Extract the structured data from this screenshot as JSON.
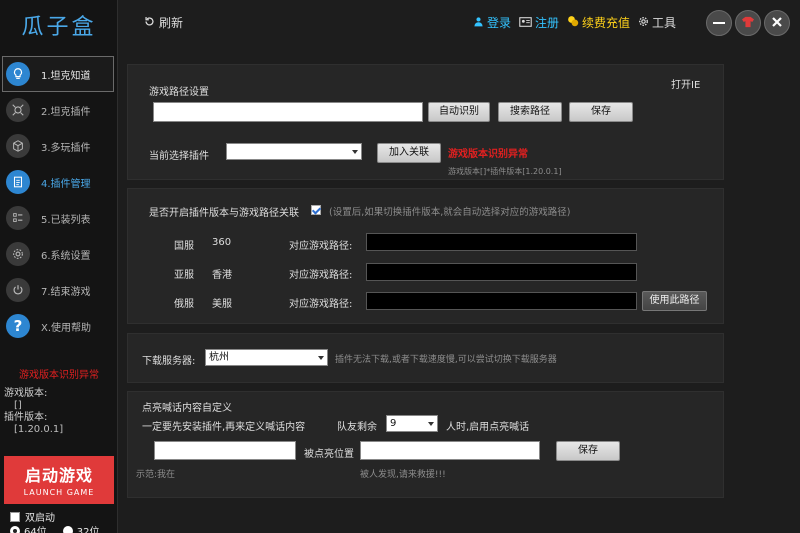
{
  "app": {
    "logo": "瓜子盒"
  },
  "sidebar": {
    "items": [
      {
        "label": "1.坦克知道"
      },
      {
        "label": "2.坦克插件"
      },
      {
        "label": "3.多玩插件"
      },
      {
        "label": "4.插件管理"
      },
      {
        "label": "5.已装列表"
      },
      {
        "label": "6.系统设置"
      },
      {
        "label": "7.结束游戏"
      },
      {
        "label": "X.使用帮助"
      }
    ],
    "status_error": "游戏版本识别异常",
    "game_version_label": "游戏版本:",
    "game_version_value": "[]",
    "plugin_version_label": "插件版本:",
    "plugin_version_value": "[1.20.0.1]",
    "launch_title": "启动游戏",
    "launch_sub": "LAUNCH GAME",
    "dual_label": "双启动",
    "bit64_label": "64位",
    "bit32_label": "32位"
  },
  "topbar": {
    "refresh": "刷新",
    "login": "登录",
    "register": "注册",
    "recharge": "续费充值",
    "tools": "工具"
  },
  "path_panel": {
    "title": "游戏路径设置",
    "open_ie": "打开IE",
    "path_value": "",
    "auto_detect": "自动识别",
    "search_path": "搜索路径",
    "save": "保存",
    "current_plugin_label": "当前选择插件",
    "current_plugin_value": "",
    "link_button": "加入关联",
    "version_error": "游戏版本识别异常",
    "version_info": "游戏版本[]*插件版本[1.20.0.1]"
  },
  "server_panel": {
    "question": "是否开启插件版本与游戏路径关联",
    "note": "(设置后,如果切换插件版本,就会自动选择对应的游戏路径)",
    "rows": [
      {
        "region": "国服",
        "server": "360",
        "path_label": "对应游戏路径:",
        "path": ""
      },
      {
        "region": "亚服",
        "server": "香港",
        "path_label": "对应游戏路径:",
        "path": ""
      },
      {
        "region": "俄服",
        "server": "美服",
        "path_label": "对应游戏路径:",
        "path": ""
      }
    ],
    "use_path": "使用此路径"
  },
  "download_panel": {
    "label": "下载服务器:",
    "value": "杭州",
    "hint": "插件无法下载,或者下载速度慢,可以尝试切换下载服务器"
  },
  "callout_panel": {
    "title": "点亮喊话内容自定义",
    "desc": "一定要先安装插件,再来定义喊话内容",
    "teammates_label": "队友剩余",
    "teammates_value": "9",
    "teammates_suffix": "人时,启用点亮喊话",
    "spotted_label": "被点亮位置",
    "input1_value": "",
    "input2_value": "",
    "save": "保存",
    "example1": "示范:我在",
    "example2": "被人发现,请来救援!!!"
  },
  "colors": {
    "accent": "#2d86d1",
    "error": "#e02020",
    "link_cyan": "#33c3ff",
    "link_yellow": "#ffd21a",
    "launch": "#e03a3a"
  }
}
